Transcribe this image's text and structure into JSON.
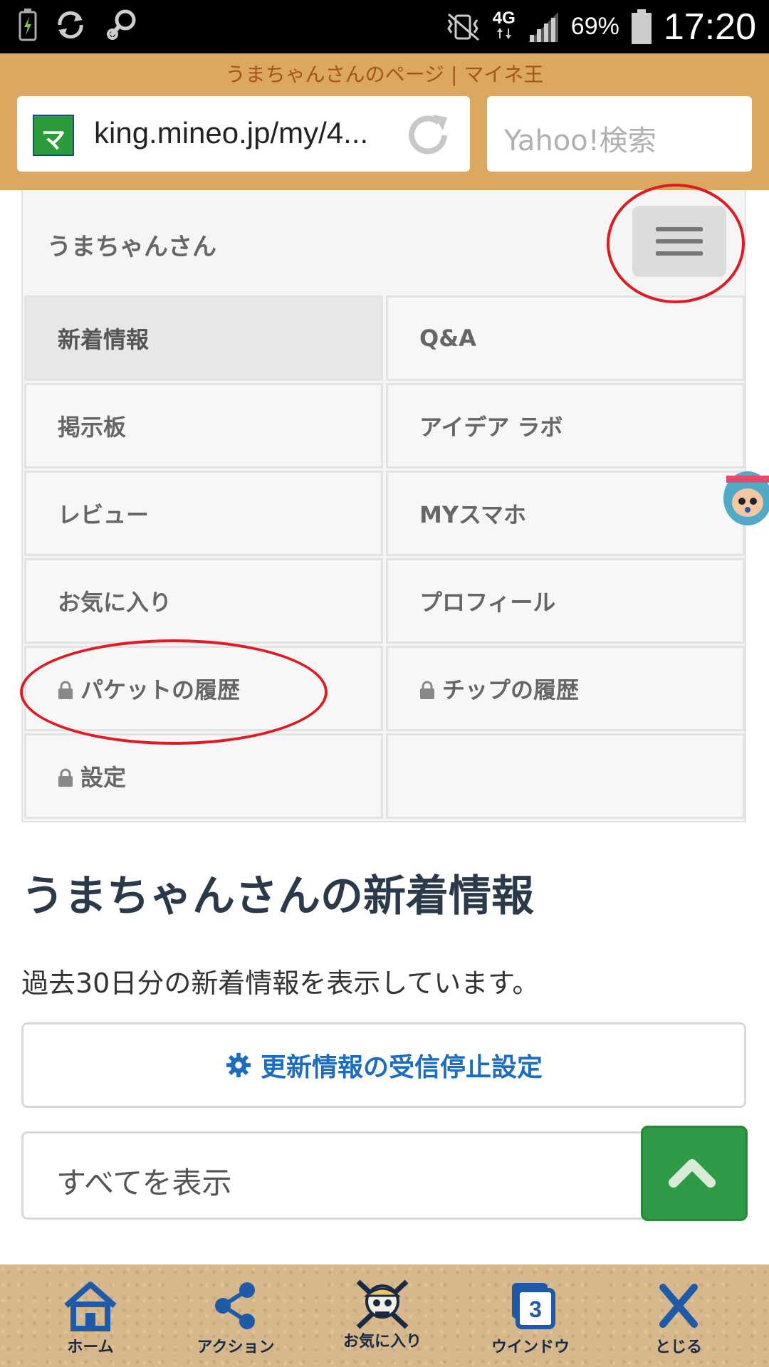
{
  "status_bar": {
    "network": "4G",
    "battery_percent": "69%",
    "time": "17:20"
  },
  "browser": {
    "page_title": "うまちゃんさんのページ | マイネ王",
    "url": "king.mineo.jp/my/4...",
    "search_placeholder": "Yahoo!検索"
  },
  "nav": {
    "brand": "うまちゃんさん",
    "items": [
      {
        "label": "新着情報",
        "locked": false,
        "active": true
      },
      {
        "label": "Q&A",
        "locked": false,
        "active": false
      },
      {
        "label": "掲示板",
        "locked": false,
        "active": false
      },
      {
        "label": "アイデア ラボ",
        "locked": false,
        "active": false
      },
      {
        "label": "レビュー",
        "locked": false,
        "active": false
      },
      {
        "label": "MYスマホ",
        "locked": false,
        "active": false
      },
      {
        "label": "お気に入り",
        "locked": false,
        "active": false
      },
      {
        "label": "プロフィール",
        "locked": false,
        "active": false
      },
      {
        "label": "パケットの履歴",
        "locked": true,
        "active": false
      },
      {
        "label": "チップの履歴",
        "locked": true,
        "active": false
      },
      {
        "label": "設定",
        "locked": true,
        "active": false
      }
    ]
  },
  "main": {
    "heading": "うまちゃんさんの新着情報",
    "subtext": "過去30日分の新着情報を表示しています。",
    "unsubscribe_button": "更新情報の受信停止設定",
    "filter_select": "すべてを表示"
  },
  "toolbar": {
    "items": [
      {
        "label": "ホーム",
        "icon": "home-icon"
      },
      {
        "label": "アクション",
        "icon": "share-icon"
      },
      {
        "label": "お気に入り",
        "icon": "skull-flag-icon"
      },
      {
        "label": "ウインドウ",
        "icon": "windows-icon",
        "count": "3"
      },
      {
        "label": "とじる",
        "icon": "close-icon"
      }
    ]
  },
  "colors": {
    "chrome": "#dca861",
    "title": "#a4551a",
    "link_blue": "#1c6cc0",
    "scroll_top_green": "#2f9a45",
    "annotation_red": "#e01a23"
  }
}
